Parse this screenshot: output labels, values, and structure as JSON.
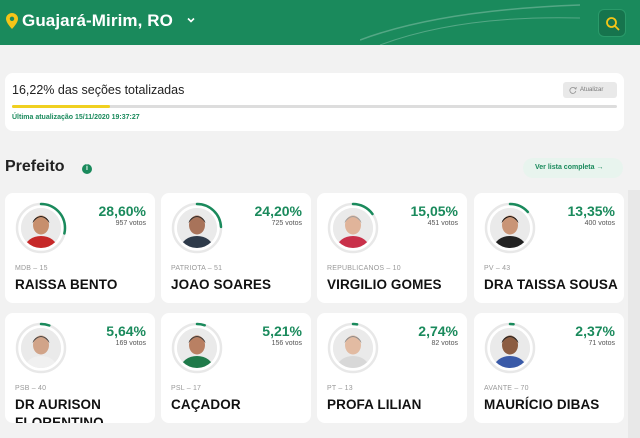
{
  "header": {
    "city": "Guajará-Mirim, RO",
    "location_icon": "map-pin-icon",
    "dropdown_icon": "chevron-down-icon",
    "search_icon": "search-icon",
    "bg_color": "#1a8a5c",
    "pin_color": "#f5c518"
  },
  "status": {
    "title": "16,22% das seções totalizadas",
    "refresh_label": "Atualizar",
    "progress": 0.1622,
    "updated": "Última atualização 15/11/2020 19:37:27"
  },
  "section": {
    "title": "Prefeito",
    "info_icon": "info-icon",
    "full_list_label": "Ver lista completa →"
  },
  "candidates": [
    {
      "pct": "28,60%",
      "votes": "957 votos",
      "party": "MDB – 15",
      "name": "RAISSA BENTO",
      "share": 0.286
    },
    {
      "pct": "24,20%",
      "votes": "725 votos",
      "party": "PATRIOTA – 51",
      "name": "JOAO SOARES",
      "share": 0.242
    },
    {
      "pct": "15,05%",
      "votes": "451 votos",
      "party": "REPUBLICANOS – 10",
      "name": "VIRGILIO GOMES",
      "share": 0.1505
    },
    {
      "pct": "13,35%",
      "votes": "400 votos",
      "party": "PV – 43",
      "name": "DRA TAISSA SOUSA",
      "share": 0.1335
    },
    {
      "pct": "5,64%",
      "votes": "169 votos",
      "party": "PSB – 40",
      "name": "DR AURISON FLORENTINO",
      "share": 0.0564
    },
    {
      "pct": "5,21%",
      "votes": "156 votos",
      "party": "PSL – 17",
      "name": "CAÇADOR",
      "share": 0.0521
    },
    {
      "pct": "2,74%",
      "votes": "82 votos",
      "party": "PT – 13",
      "name": "PROFA LILIAN",
      "share": 0.0274
    },
    {
      "pct": "2,37%",
      "votes": "71 votos",
      "party": "AVANTE – 70",
      "name": "MAURÍCIO DIBAS",
      "share": 0.0237
    }
  ]
}
